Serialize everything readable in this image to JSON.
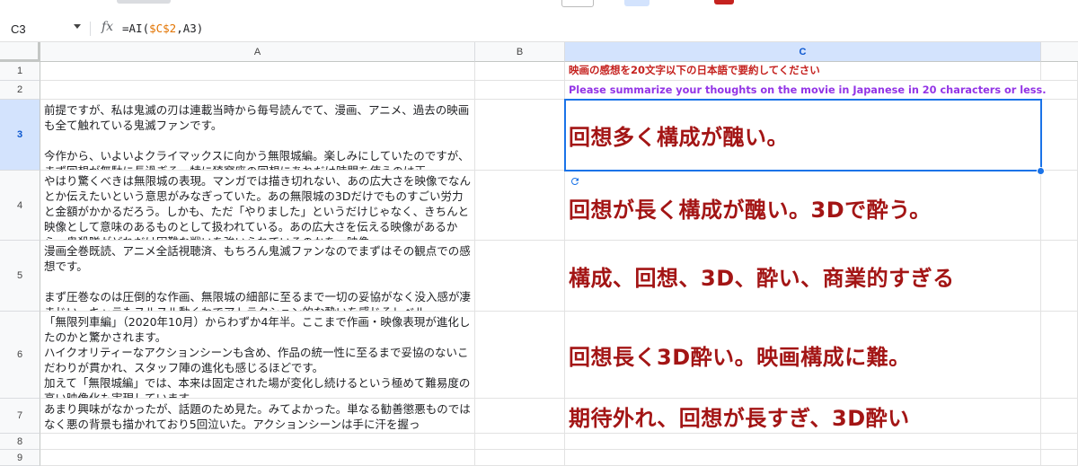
{
  "formula_bar": {
    "cell_ref": "C3",
    "fx_label": "fx",
    "formula_prefix": "=AI(",
    "formula_ref1": "$C$2",
    "formula_suffix": ",A3)"
  },
  "columns": [
    "A",
    "B",
    "C"
  ],
  "rows": [
    "1",
    "2",
    "3",
    "4",
    "5",
    "6",
    "7",
    "8",
    "9"
  ],
  "cells": {
    "C1": "映画の感想を20文字以下の日本語で要約してください",
    "C2": "Please summarize your thoughts on the movie in Japanese in 20 characters or less.",
    "A3": "前提ですが、私は鬼滅の刃は連載当時から毎号読んでて、漫画、アニメ、過去の映画も全て触れている鬼滅ファンです。\n\n今作から、いよいよクライマックスに向かう無限城編。楽しみにしていたのですが、まず回想が無駄に長過ぎる。特に猗窩座の回想にあれだけ時間を使うのは正",
    "A4": "やはり驚くべきは無限城の表現。マンガでは描き切れない、あの広大さを映像でなんとか伝えたいという意思がみなぎっていた。あの無限城の3Dだけでものすごい労力と金額がかかるだろう。しかも、ただ「やりました」というだけじゃなく、きちんと映像として意味のあるものとして扱われている。あの広大さを伝える映像があるから、鬼殺隊がどれだけ困難な戦いを強いられているのかを、映像",
    "A5": "漫画全巻既読、アニメ全話視聴済、もちろん鬼滅ファンなのでまずはその観点での感想です。\n\nまず圧巻なのは圧倒的な作画、無限城の細部に至るまで一切の妥協がなく没入感が凄まじい。キャラもヌルヌル動くわでアトラクション的な酔いを感じるレベル",
    "A6": "「無限列車編」（2020年10月）からわずか4年半。ここまで作画・映像表現が進化したのかと驚かされます。\nハイクオリティーなアクションシーンも含め、作品の統一性に至るまで妥協のないこだわりが貫かれ、スタッフ陣の進化も感じるほどです。\n加えて「無限城編」では、本来は固定された場が変化し続けるという極めて難易度の高い映像化も実現しています。",
    "A7": "あまり興味がなかったが、話題のため見た。みてよかった。単なる勧善懲悪ものではなく悪の背景も描かれており5回泣いた。アクションシーンは手に汗を握っ",
    "C3": "回想多く構成が醜い。",
    "C4": "回想が長く構成が醜い。3Dで酔う。",
    "C5": "構成、回想、3D、酔い、商業的すぎる",
    "C6": "回想長く3D酔い。映画構成に難。",
    "C7": "期待外れ、回想が長すぎ、3D酔い"
  },
  "icons": {
    "dropdown": "chevron-down-icon",
    "function": "fx-icon",
    "refresh": "refresh-icon"
  },
  "colors": {
    "c1_text": "#c5221f",
    "c2_text": "#9334e6",
    "result_text": "#a31515",
    "selection": "#1a73e8",
    "header_selected": "#d3e3fd",
    "formula_ref": "#e37400"
  }
}
